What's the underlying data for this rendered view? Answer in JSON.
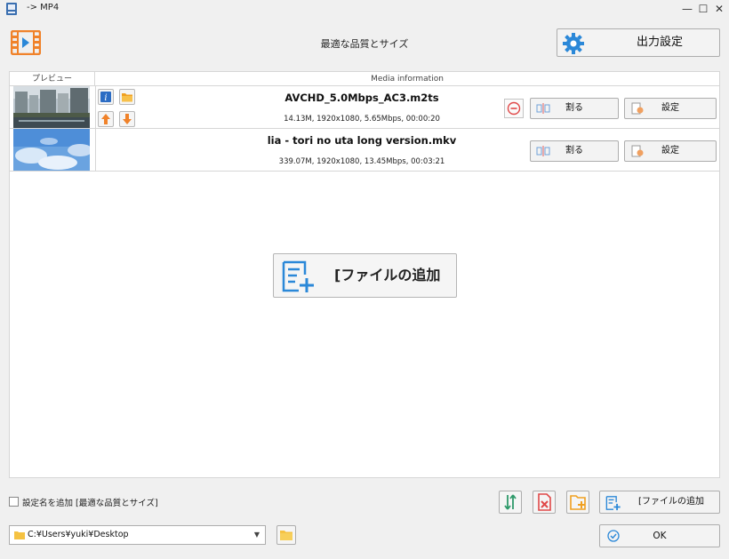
{
  "window": {
    "title": "-> MP4",
    "minimize_glyph": "—",
    "maximize_glyph": "☐",
    "close_glyph": "✕"
  },
  "header": {
    "preset_name": "最適な品質とサイズ",
    "output_settings_label": "出力設定"
  },
  "list": {
    "col_preview": "プレビュー",
    "col_media": "Media information",
    "rows": [
      {
        "filename": "AVCHD_5.0Mbps_AC3.m2ts",
        "detail": "14.13M, 1920x1080, 5.65Mbps, 00:00:20",
        "split_label": "割る",
        "settings_label": "設定"
      },
      {
        "filename": "lia - tori no uta long version.mkv",
        "detail": "339.07M, 1920x1080, 13.45Mbps, 00:03:21",
        "split_label": "割る",
        "settings_label": "設定"
      }
    ],
    "add_file_label": "[ファイルの追加"
  },
  "footer": {
    "add_name_label": "設定名を追加 [最適な品質とサイズ]",
    "add_name_checked": false,
    "add_file_label": "[ファイルの追加",
    "path_value": "C:¥Users¥yuki¥Desktop",
    "ok_label": "OK"
  },
  "colors": {
    "accent_orange": "#f0822a",
    "accent_blue": "#2b88d8",
    "remove_red": "#e04848",
    "folder_yellow": "#f5c242"
  }
}
